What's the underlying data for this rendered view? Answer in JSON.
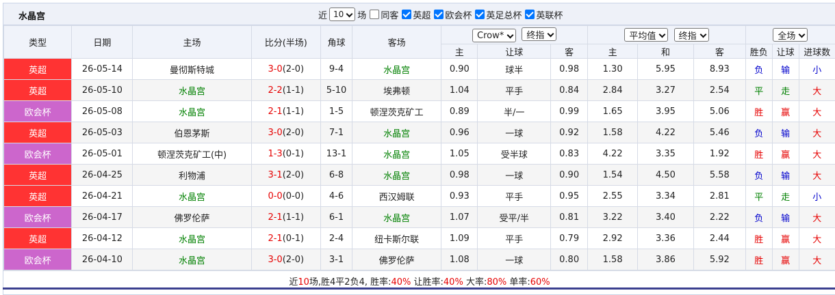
{
  "team_title": "水晶宫",
  "filters": {
    "recent_prefix": "近",
    "recent_count": "10",
    "recent_suffix": "场",
    "same_home_label": "同客",
    "same_home_checked": false,
    "leagues": [
      {
        "label": "英超",
        "checked": true
      },
      {
        "label": "欧会杯",
        "checked": true
      },
      {
        "label": "英足总杯",
        "checked": true
      },
      {
        "label": "英联杯",
        "checked": true
      }
    ]
  },
  "header": {
    "type": "类型",
    "date": "日期",
    "home": "主场",
    "score": "比分(半场)",
    "corners": "角球",
    "away": "客场",
    "company_select": "Crow*",
    "handicap_select": "终指",
    "avg_select": "平均值",
    "odds_select": "终指",
    "period_select": "全场",
    "sub": {
      "h_home": "主",
      "h_line": "让球",
      "h_away": "客",
      "o_home": "主",
      "o_draw": "和",
      "o_away": "客",
      "wdl": "胜负",
      "ah": "让球",
      "goals": "进球数"
    }
  },
  "colors": {
    "英超": "#ff3333",
    "欧会杯": "#cc66cc"
  },
  "rows": [
    {
      "league": "英超",
      "date": "26-05-14",
      "home": "曼彻斯特城",
      "home_green": false,
      "score": "3-0",
      "half": "(2-0)",
      "corners": "9-4",
      "away": "水晶宫",
      "away_green": true,
      "h_home": "0.90",
      "h_line": "球半",
      "h_away": "0.98",
      "o_home": "1.30",
      "o_draw": "5.95",
      "o_away": "8.93",
      "wdl": "负",
      "ah": "输",
      "goals": "小"
    },
    {
      "league": "英超",
      "date": "26-05-10",
      "home": "水晶宫",
      "home_green": true,
      "score": "2-2",
      "half": "(1-1)",
      "corners": "5-10",
      "away": "埃弗顿",
      "away_green": false,
      "h_home": "1.04",
      "h_line": "平手",
      "h_away": "0.84",
      "o_home": "2.84",
      "o_draw": "3.27",
      "o_away": "2.54",
      "wdl": "平",
      "ah": "走",
      "goals": "大"
    },
    {
      "league": "欧会杯",
      "date": "26-05-08",
      "home": "水晶宫",
      "home_green": true,
      "score": "2-1",
      "half": "(1-1)",
      "corners": "1-5",
      "away": "顿涅茨克矿工",
      "away_green": false,
      "h_home": "0.89",
      "h_line": "半/一",
      "h_away": "0.99",
      "o_home": "1.65",
      "o_draw": "3.95",
      "o_away": "5.06",
      "wdl": "胜",
      "ah": "赢",
      "goals": "大"
    },
    {
      "league": "英超",
      "date": "26-05-03",
      "home": "伯恩茅斯",
      "home_green": false,
      "score": "3-0",
      "half": "(2-0)",
      "corners": "7-1",
      "away": "水晶宫",
      "away_green": true,
      "h_home": "0.96",
      "h_line": "一球",
      "h_away": "0.92",
      "o_home": "1.58",
      "o_draw": "4.22",
      "o_away": "5.46",
      "wdl": "负",
      "ah": "输",
      "goals": "大"
    },
    {
      "league": "欧会杯",
      "date": "26-05-01",
      "home": "顿涅茨克矿工(中)",
      "home_green": false,
      "score": "1-3",
      "half": "(0-1)",
      "corners": "13-1",
      "away": "水晶宫",
      "away_green": true,
      "h_home": "1.05",
      "h_line": "受半球",
      "h_away": "0.83",
      "o_home": "4.22",
      "o_draw": "3.35",
      "o_away": "1.92",
      "wdl": "胜",
      "ah": "赢",
      "goals": "大"
    },
    {
      "league": "英超",
      "date": "26-04-25",
      "home": "利物浦",
      "home_green": false,
      "score": "3-1",
      "half": "(2-0)",
      "corners": "6-8",
      "away": "水晶宫",
      "away_green": true,
      "h_home": "0.98",
      "h_line": "一球",
      "h_away": "0.90",
      "o_home": "1.54",
      "o_draw": "4.50",
      "o_away": "5.58",
      "wdl": "负",
      "ah": "输",
      "goals": "大"
    },
    {
      "league": "英超",
      "date": "26-04-21",
      "home": "水晶宫",
      "home_green": true,
      "score": "0-0",
      "half": "(0-0)",
      "corners": "4-6",
      "away": "西汉姆联",
      "away_green": false,
      "h_home": "0.93",
      "h_line": "平手",
      "h_away": "0.95",
      "o_home": "2.55",
      "o_draw": "3.34",
      "o_away": "2.81",
      "wdl": "平",
      "ah": "走",
      "goals": "小"
    },
    {
      "league": "欧会杯",
      "date": "26-04-17",
      "home": "佛罗伦萨",
      "home_green": false,
      "score": "2-1",
      "half": "(1-1)",
      "corners": "6-1",
      "away": "水晶宫",
      "away_green": true,
      "h_home": "1.07",
      "h_line": "受平/半",
      "h_away": "0.81",
      "o_home": "3.22",
      "o_draw": "3.40",
      "o_away": "2.22",
      "wdl": "负",
      "ah": "输",
      "goals": "大"
    },
    {
      "league": "英超",
      "date": "26-04-12",
      "home": "水晶宫",
      "home_green": true,
      "score": "2-1",
      "half": "(0-1)",
      "corners": "2-4",
      "away": "纽卡斯尔联",
      "away_green": false,
      "h_home": "1.09",
      "h_line": "平手",
      "h_away": "0.79",
      "o_home": "2.92",
      "o_draw": "3.36",
      "o_away": "2.44",
      "wdl": "胜",
      "ah": "赢",
      "goals": "大"
    },
    {
      "league": "欧会杯",
      "date": "26-04-10",
      "home": "水晶宫",
      "home_green": true,
      "score": "3-0",
      "half": "(2-0)",
      "corners": "3-1",
      "away": "佛罗伦萨",
      "away_green": false,
      "h_home": "1.08",
      "h_line": "一球",
      "h_away": "0.80",
      "o_home": "1.58",
      "o_draw": "3.86",
      "o_away": "5.92",
      "wdl": "胜",
      "ah": "赢",
      "goals": "大"
    }
  ],
  "summary": {
    "prefix": "近",
    "count": "10",
    "mid": "场,胜4平2负4, 胜率:",
    "win_rate": "40%",
    "ah_label": " 让胜率:",
    "ah_rate": "40%",
    "over_label": " 大率:",
    "over_rate": "80%",
    "odd_label": " 单率:",
    "odd_rate": "60%"
  }
}
